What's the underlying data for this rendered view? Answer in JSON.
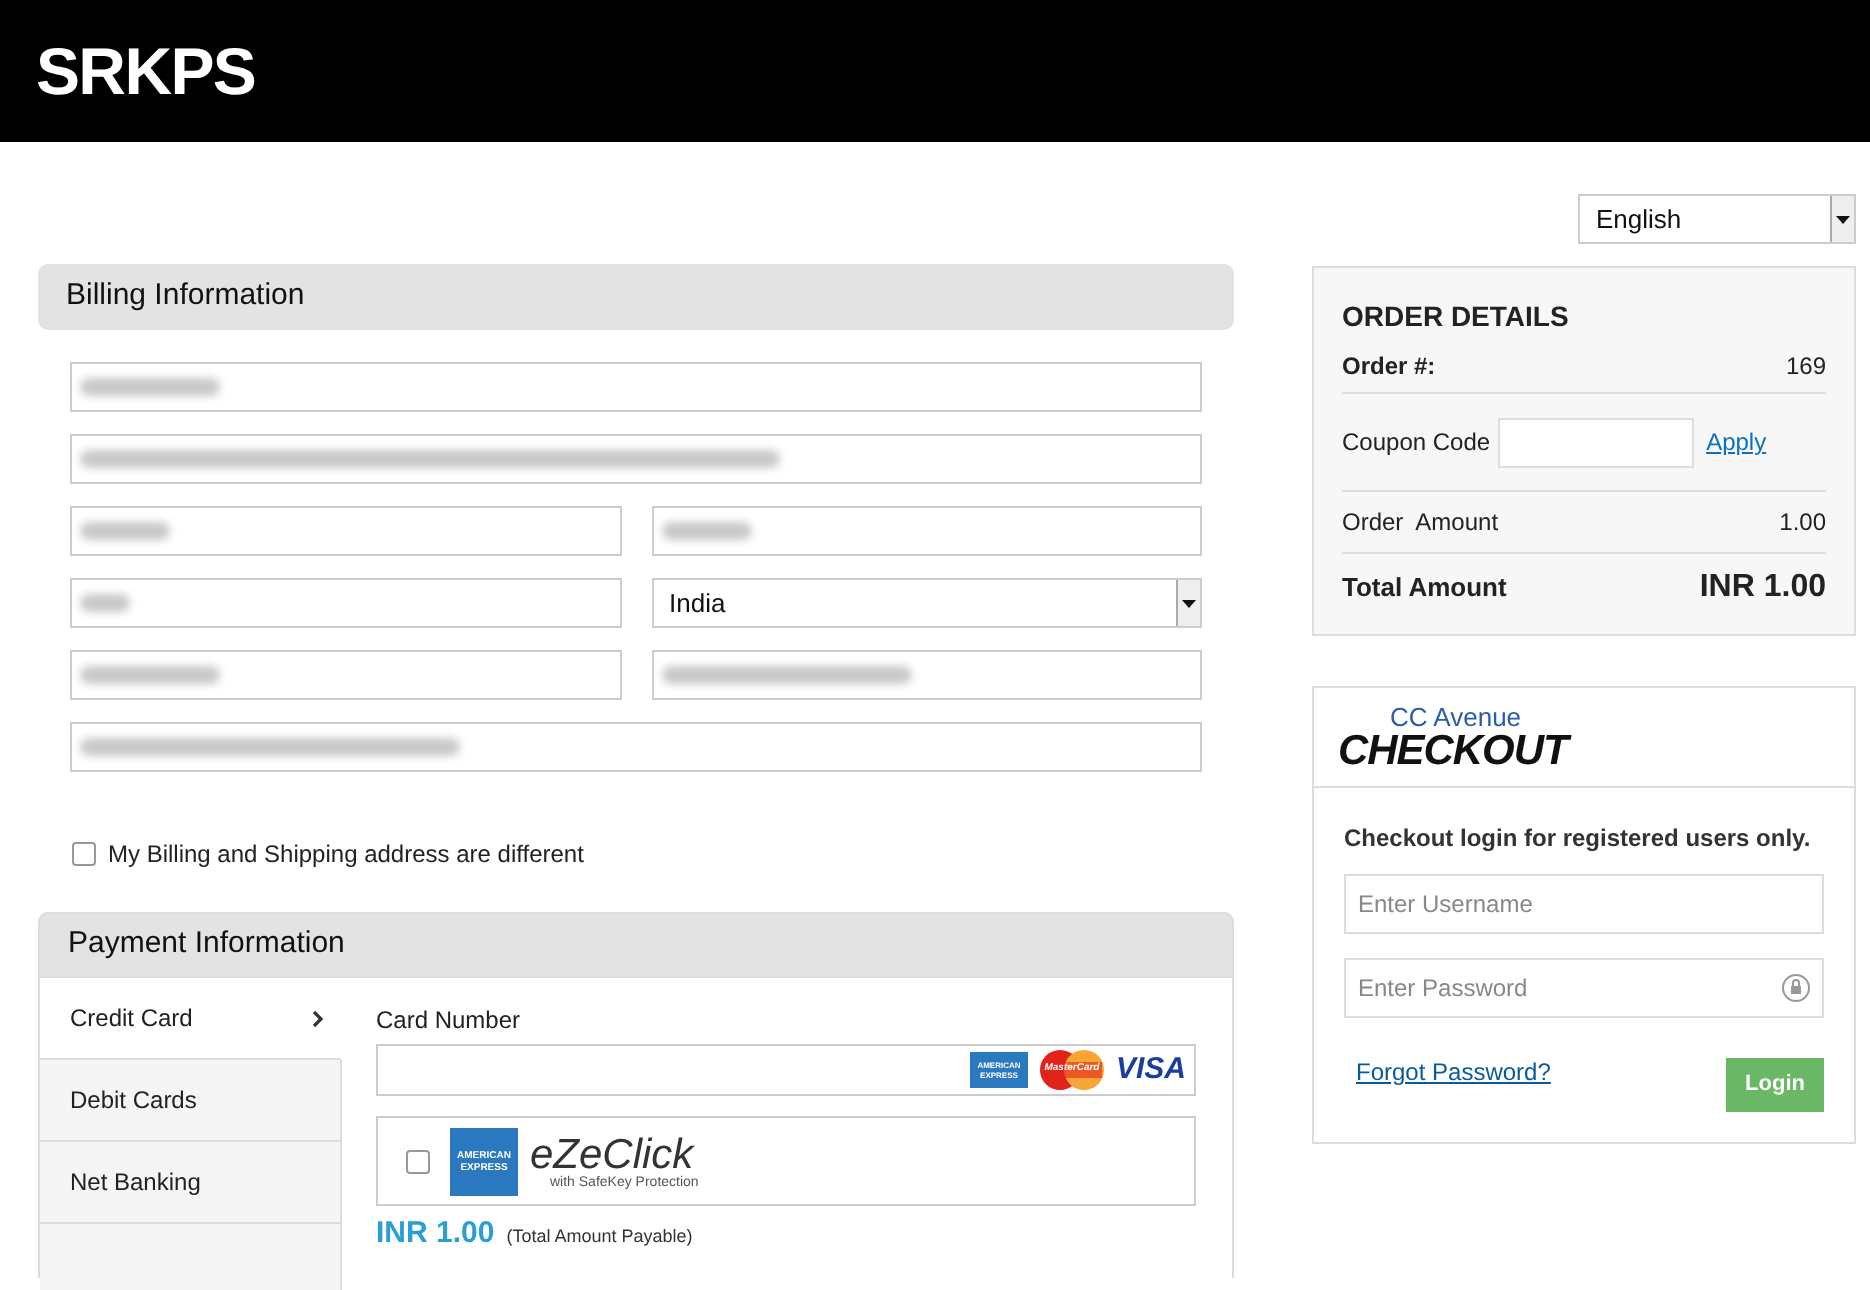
{
  "header": {
    "logo": "SRKPS"
  },
  "language": {
    "value": "English"
  },
  "billing": {
    "title": "Billing Information",
    "rows": [
      [
        {
          "kind": "text",
          "redacted": true
        }
      ],
      [
        {
          "kind": "text",
          "redacted": true
        }
      ],
      [
        {
          "kind": "text",
          "redacted": true
        },
        {
          "kind": "text",
          "redacted": true
        }
      ],
      [
        {
          "kind": "text",
          "redacted": true
        },
        {
          "kind": "select",
          "value": "India"
        }
      ],
      [
        {
          "kind": "text",
          "redacted": true
        },
        {
          "kind": "text",
          "redacted": true
        }
      ],
      [
        {
          "kind": "text",
          "redacted": true
        }
      ]
    ],
    "different_address": {
      "label": "My Billing and Shipping address are different",
      "checked": false
    }
  },
  "payment": {
    "title": "Payment Information",
    "methods": [
      {
        "label": "Credit Card",
        "selected": true
      },
      {
        "label": "Debit Cards",
        "selected": false
      },
      {
        "label": "Net Banking",
        "selected": false
      },
      {
        "selected": false
      }
    ],
    "card_number_label": "Card Number",
    "card_logos": {
      "amex": "AMERICAN EXPRESS",
      "mastercard": "MasterCard",
      "visa": "VISA"
    },
    "ezeclick": {
      "checked": false,
      "amex": "AMERICAN EXPRESS",
      "brand": "eZeClick",
      "tagline": "with SafeKey Protection"
    },
    "amount": "INR 1.00",
    "amount_note": "(Total Amount Payable)"
  },
  "order": {
    "title": "ORDER DETAILS",
    "order_label": "Order #:",
    "order_no": "169",
    "coupon_label": "Coupon Code",
    "apply": "Apply",
    "amount_label": "Order  Amount",
    "amount": "1.00",
    "total_label": "Total Amount",
    "total": "INR 1.00"
  },
  "login": {
    "logo_top": "CC Avenue",
    "logo_bottom": "CHECKOUT",
    "heading": "Checkout login for registered users only.",
    "username_placeholder": "Enter Username",
    "password_placeholder": "Enter Password",
    "forgot": "Forgot Password?",
    "button": "Login"
  }
}
